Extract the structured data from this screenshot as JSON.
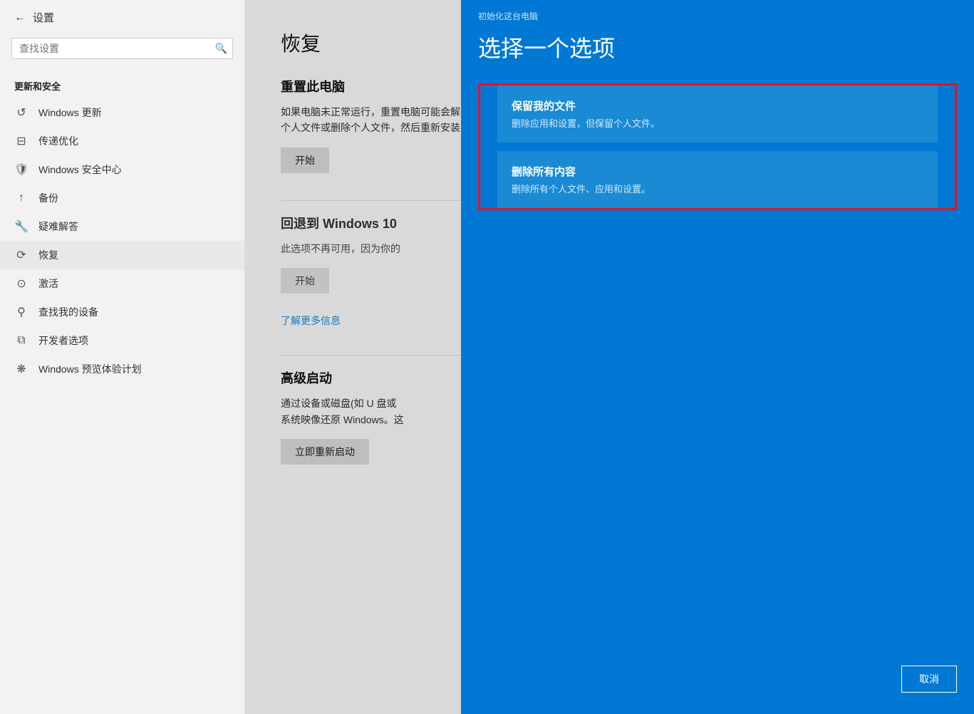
{
  "sidebar": {
    "back_label": "←",
    "title": "设置",
    "search_placeholder": "查找设置",
    "section_title": "更新和安全",
    "items": [
      {
        "id": "windows-update",
        "icon": "↺",
        "label": "Windows 更新"
      },
      {
        "id": "delivery-opt",
        "icon": "⊟",
        "label": "传递优化"
      },
      {
        "id": "windows-security",
        "icon": "🛡",
        "label": "Windows 安全中心"
      },
      {
        "id": "backup",
        "icon": "↑",
        "label": "备份"
      },
      {
        "id": "troubleshoot",
        "icon": "🔧",
        "label": "疑难解答"
      },
      {
        "id": "recovery",
        "icon": "⟳",
        "label": "恢复",
        "active": true
      },
      {
        "id": "activation",
        "icon": "⊙",
        "label": "激活"
      },
      {
        "id": "find-device",
        "icon": "⚲",
        "label": "查找我的设备"
      },
      {
        "id": "developer",
        "icon": "⧉",
        "label": "开发者选项"
      },
      {
        "id": "windows-insider",
        "icon": "❋",
        "label": "Windows 预览体验计划"
      }
    ]
  },
  "main": {
    "page_title": "恢复",
    "reset_section": {
      "title": "重置此电脑",
      "desc": "如果电脑未正常运行，重置电脑可能会解决问题。重置时，可以选择保留\n个人文件或删除个人文件，然后重新安装 Windows。",
      "btn_start": "开始"
    },
    "rollback_section": {
      "title": "回退到 Windows 10",
      "desc": "此选项不再可用，因为你的",
      "btn_start": "开始",
      "link_more": "了解更多信息"
    },
    "advanced_section": {
      "title": "高级启动",
      "desc": "通过设备或磁盘(如 U 盘或\n系统映像还原 Windows。这",
      "btn_restart": "立即重新启动"
    }
  },
  "modal": {
    "label": "初始化这台电脑",
    "title": "选择一个选项",
    "option1": {
      "title": "保留我的文件",
      "desc": "删除应用和设置，但保留个人文件。"
    },
    "option2": {
      "title": "删除所有内容",
      "desc": "删除所有个人文件、应用和设置。"
    },
    "cancel_btn": "取消"
  }
}
